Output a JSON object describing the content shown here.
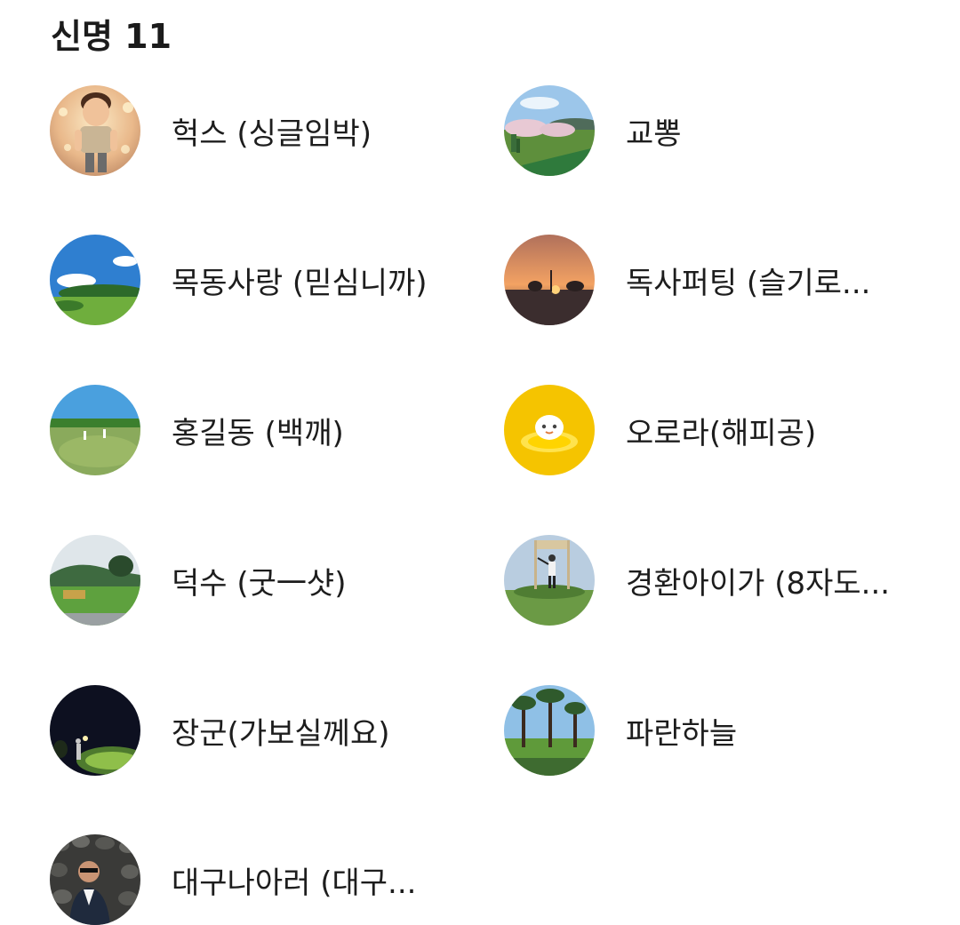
{
  "section": {
    "title": "신명 11"
  },
  "members": [
    {
      "name": "헉스 (싱글임박)",
      "avatar": "cartoon-boy-avatar"
    },
    {
      "name": "교뽕",
      "avatar": "cherry-blossom-driving-range-avatar"
    },
    {
      "name": "목동사랑 (믿심니까)",
      "avatar": "blue-sky-golf-course-avatar"
    },
    {
      "name": "독사퍼팅 (슬기로...",
      "avatar": "sunset-avatar"
    },
    {
      "name": "홍길동 (백깨)",
      "avatar": "golf-fairway-avatar"
    },
    {
      "name": "오로라(해피공)",
      "avatar": "yellow-character-avatar"
    },
    {
      "name": "덕수 (굿一샷)",
      "avatar": "hillside-golf-course-avatar"
    },
    {
      "name": "경환아이가 (8자도...",
      "avatar": "person-posing-sign-avatar"
    },
    {
      "name": "장군(가보실께요)",
      "avatar": "night-golf-avatar"
    },
    {
      "name": "파란하늘",
      "avatar": "pine-trees-course-avatar"
    },
    {
      "name": "대구나아러 (대구...",
      "avatar": "man-stone-wall-avatar"
    }
  ]
}
